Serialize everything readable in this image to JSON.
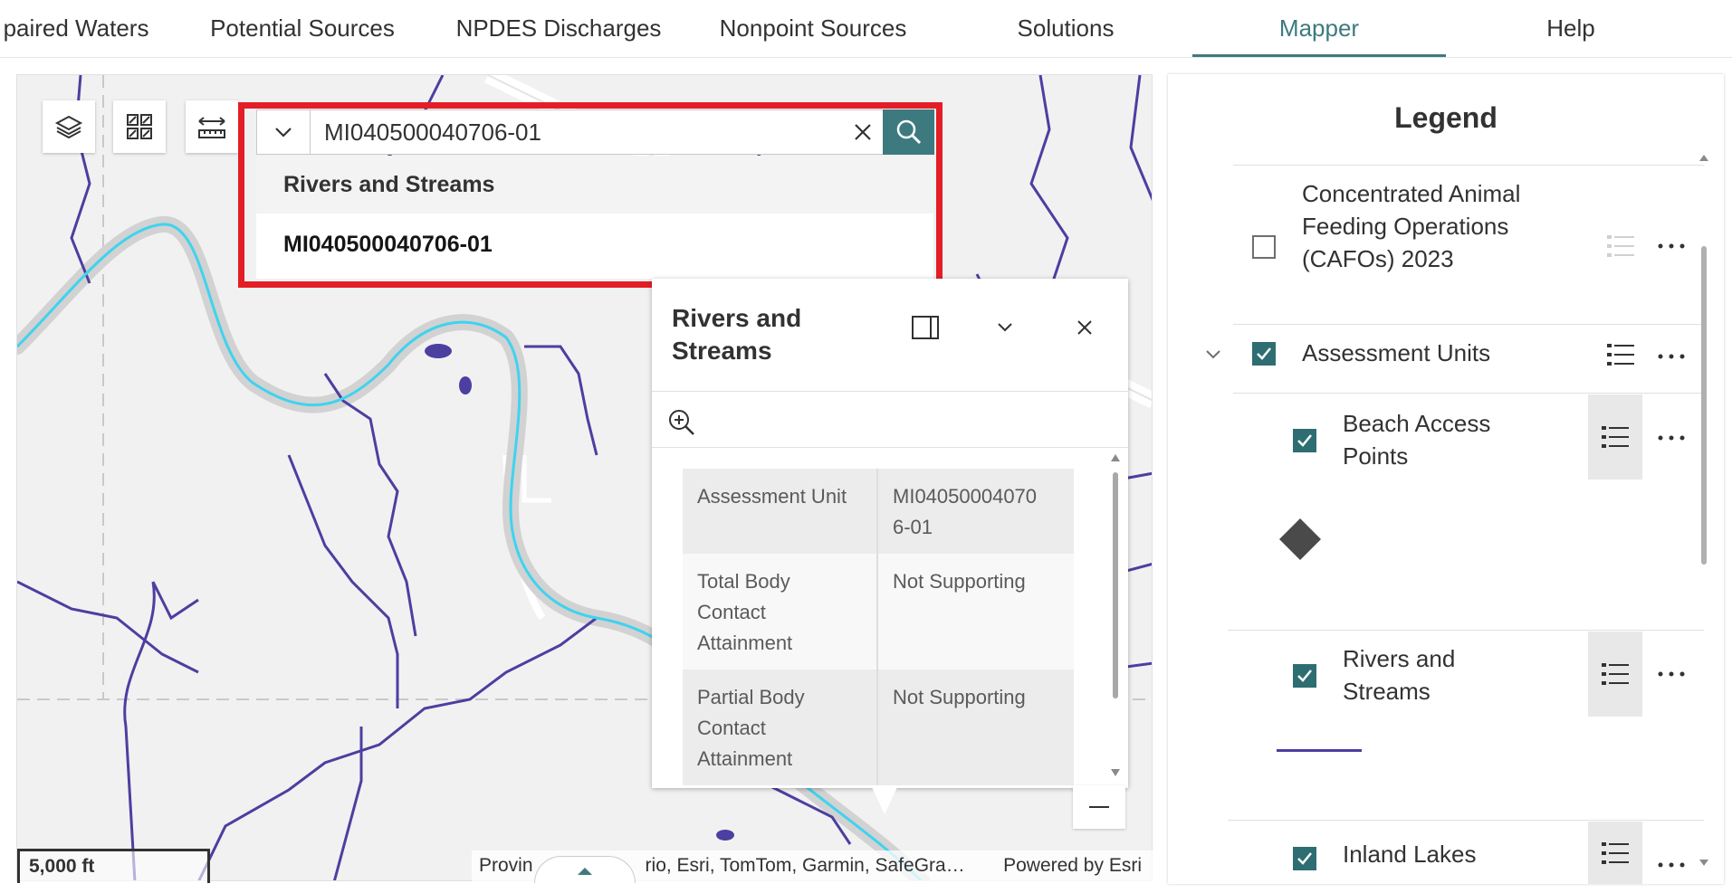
{
  "nav": {
    "items": [
      "paired Waters",
      "Potential Sources",
      "NPDES Discharges",
      "Nonpoint Sources",
      "Solutions",
      "Mapper",
      "Help"
    ],
    "active": "Mapper"
  },
  "search": {
    "value": "MI040500040706-01",
    "suggestion_group": "Rivers and Streams",
    "suggestion_item": "MI040500040706-01"
  },
  "popup": {
    "title": "Rivers and Streams",
    "rows": [
      {
        "key": "Assessment Unit",
        "value": "MI04050004070 6-01"
      },
      {
        "key": "Total Body Contact Attainment",
        "value": "Not Supporting"
      },
      {
        "key": "Partial Body Contact Attainment",
        "value": "Not Supporting"
      }
    ]
  },
  "map": {
    "scale": "5,000 ft",
    "attribution": "Provin",
    "attribution_tail": "rio, Esri, TomTom, Garmin, SafeGra…",
    "powered_by": "Powered by Esri"
  },
  "legend": {
    "title": "Legend",
    "layers": {
      "cafo": "Concentrated Animal Feeding Operations (CAFOs) 2023",
      "assessment_units": "Assessment Units",
      "beach_access": "Beach Access Points",
      "rivers": "Rivers and Streams",
      "inland_lakes": "Inland Lakes"
    }
  },
  "colors": {
    "accent": "#3d7a80",
    "highlight": "#e41e26",
    "river_line": "#4b3fa0",
    "selected_river": "#3fd3ef"
  },
  "icons": [
    "layers-icon",
    "basemap-gallery-icon",
    "measure-icon",
    "chevron-down-icon",
    "close-icon",
    "search-icon",
    "dock-icon",
    "zoom-to-icon",
    "zoom-out-icon",
    "list-icon",
    "more-icon",
    "diamond-icon"
  ]
}
